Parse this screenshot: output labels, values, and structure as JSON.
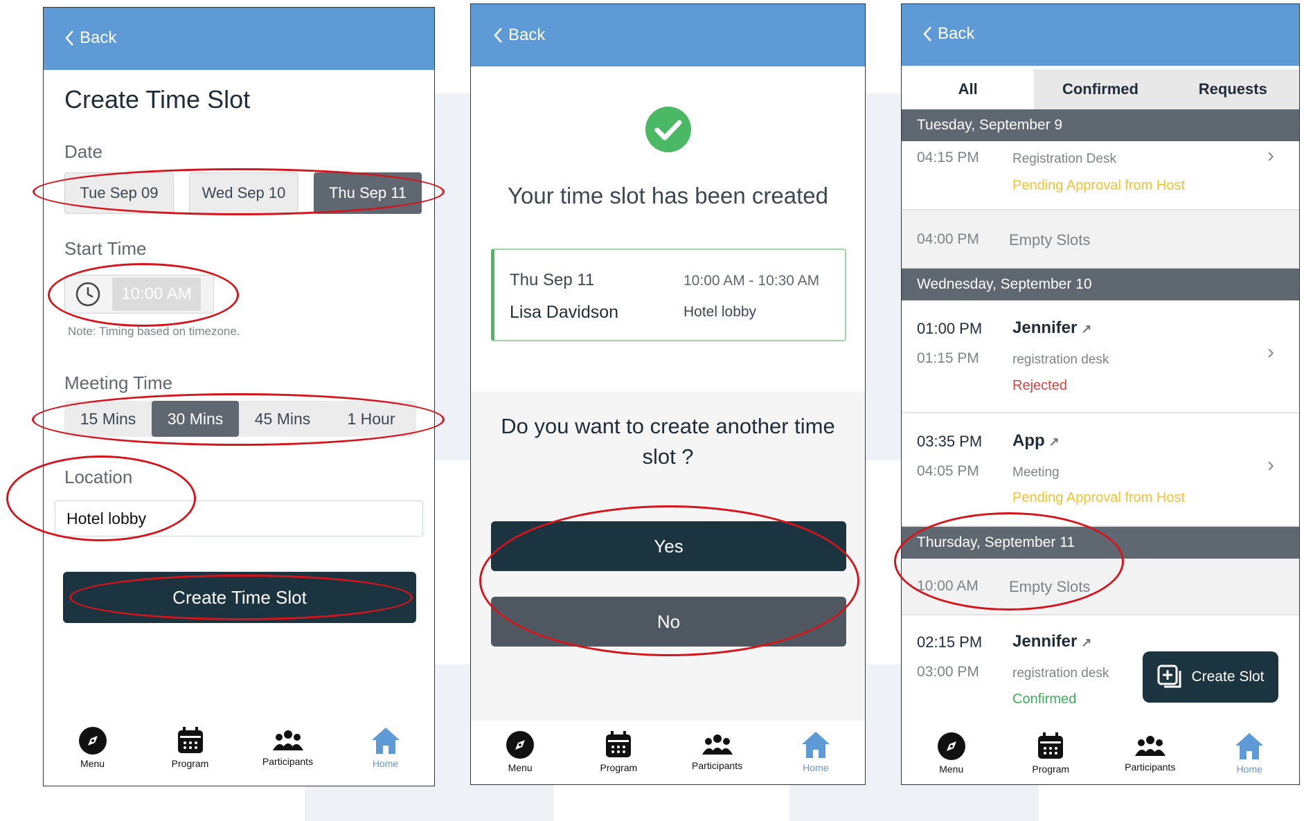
{
  "common": {
    "back_label": "Back",
    "nav": [
      {
        "label": "Menu",
        "icon": "compass-icon"
      },
      {
        "label": "Program",
        "icon": "calendar-icon"
      },
      {
        "label": "Participants",
        "icon": "people-icon"
      },
      {
        "label": "Home",
        "icon": "home-icon"
      }
    ],
    "accent_color": "#5d9ad6",
    "annotation_color": "#d6141b"
  },
  "create_screen": {
    "title": "Create Time Slot",
    "date_label": "Date",
    "dates": [
      "Tue Sep 09",
      "Wed Sep 10",
      "Thu Sep 11"
    ],
    "selected_date": "Thu Sep 11",
    "start_time_label": "Start Time",
    "start_time_value": "10:00 AM",
    "note": "Note: Timing based on  timezone.",
    "meeting_time_label": "Meeting Time",
    "durations": [
      "15 Mins",
      "30 Mins",
      "45 Mins",
      "1 Hour"
    ],
    "selected_duration": "30 Mins",
    "location_label": "Location",
    "location_value": "Hotel lobby",
    "submit_label": "Create Time Slot"
  },
  "confirm_screen": {
    "message": "Your time slot has been created",
    "card": {
      "date": "Thu Sep 11",
      "time_range": "10:00 AM - 10:30 AM",
      "person": "Lisa Davidson",
      "location": "Hotel lobby"
    },
    "question": "Do you want to create another time slot ?",
    "yes_label": "Yes",
    "no_label": "No"
  },
  "schedule_screen": {
    "tabs": [
      "All",
      "Confirmed",
      "Requests"
    ],
    "active_tab": "All",
    "days": [
      {
        "header": "Tuesday, September 9"
      },
      {
        "header": "Wednesday, September 10"
      },
      {
        "header": "Thursday, September 11"
      }
    ],
    "items": {
      "tue_1": {
        "time": "04:15 PM",
        "location": "Registration Desk",
        "status": "Pending Approval from Host"
      },
      "tue_empty": {
        "time": "04:00 PM",
        "label": "Empty Slots"
      },
      "wed_1": {
        "start": "01:00 PM",
        "end": "01:15 PM",
        "name": "Jennifer",
        "location": "registration desk",
        "status": "Rejected"
      },
      "wed_2": {
        "start": "03:35 PM",
        "end": "04:05 PM",
        "name": "App",
        "location": "Meeting",
        "status": "Pending Approval from Host"
      },
      "thu_empty": {
        "time": "10:00 AM",
        "label": "Empty Slots"
      },
      "thu_1": {
        "start": "02:15 PM",
        "end": "03:00 PM",
        "name": "Jennifer",
        "location": "registration desk",
        "status": "Confirmed"
      }
    },
    "create_slot_label": "Create Slot",
    "status_colors": {
      "pending": "#f2c230",
      "rejected": "#d9413b",
      "confirmed": "#3cb15a"
    }
  }
}
